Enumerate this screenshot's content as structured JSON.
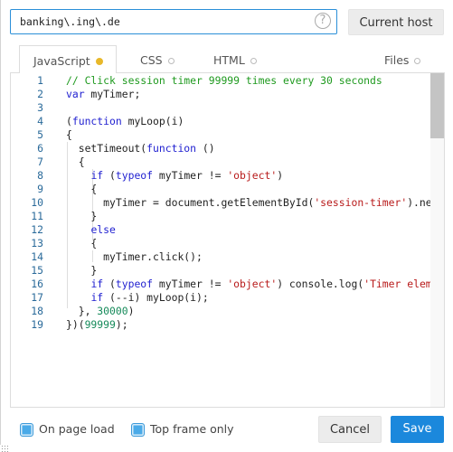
{
  "host": {
    "value": "banking\\.ing\\.de",
    "help_icon": "question-circle-icon",
    "current_host_label": "Current host"
  },
  "tabs": [
    {
      "label": "JavaScript",
      "active": true,
      "status": "modified",
      "dot_color": "#e8b82a"
    },
    {
      "label": "CSS",
      "active": false,
      "status": "empty"
    },
    {
      "label": "HTML",
      "active": false,
      "status": "empty"
    },
    {
      "label": "Files",
      "active": false,
      "status": "empty"
    }
  ],
  "editor": {
    "line_numbers": [
      "1",
      "2",
      "3",
      "4",
      "5",
      "6",
      "7",
      "8",
      "9",
      "10",
      "11",
      "12",
      "13",
      "14",
      "15",
      "16",
      "17",
      "18",
      "19"
    ],
    "lines": [
      [
        [
          "comment",
          "// Click session timer 99999 times every 30 seconds"
        ]
      ],
      [
        [
          "keyword",
          "var"
        ],
        [
          "plain",
          " myTimer;"
        ]
      ],
      [],
      [
        [
          "plain",
          "("
        ],
        [
          "keyword",
          "function"
        ],
        [
          "plain",
          " myLoop(i)"
        ]
      ],
      [
        [
          "plain",
          "{"
        ]
      ],
      [
        [
          "plain",
          "  setTimeout("
        ],
        [
          "keyword",
          "function"
        ],
        [
          "plain",
          " ()"
        ]
      ],
      [
        [
          "plain",
          "  {"
        ]
      ],
      [
        [
          "plain",
          "    "
        ],
        [
          "keyword",
          "if"
        ],
        [
          "plain",
          " ("
        ],
        [
          "keyword",
          "typeof"
        ],
        [
          "plain",
          " myTimer != "
        ],
        [
          "string",
          "'object'"
        ],
        [
          "plain",
          ")"
        ]
      ],
      [
        [
          "plain",
          "    {"
        ]
      ],
      [
        [
          "plain",
          "      myTimer = document.getElementById("
        ],
        [
          "string",
          "'session-timer'"
        ],
        [
          "plain",
          ").nex"
        ]
      ],
      [
        [
          "plain",
          "    }"
        ]
      ],
      [
        [
          "plain",
          "    "
        ],
        [
          "keyword",
          "else"
        ]
      ],
      [
        [
          "plain",
          "    {"
        ]
      ],
      [
        [
          "plain",
          "      myTimer.click();"
        ]
      ],
      [
        [
          "plain",
          "    }"
        ]
      ],
      [
        [
          "plain",
          "    "
        ],
        [
          "keyword",
          "if"
        ],
        [
          "plain",
          " ("
        ],
        [
          "keyword",
          "typeof"
        ],
        [
          "plain",
          " myTimer != "
        ],
        [
          "string",
          "'object'"
        ],
        [
          "plain",
          ") console.log("
        ],
        [
          "string",
          "'Timer eleme"
        ]
      ],
      [
        [
          "plain",
          "    "
        ],
        [
          "keyword",
          "if"
        ],
        [
          "plain",
          " (--i) myLoop(i);"
        ]
      ],
      [
        [
          "plain",
          "  }, "
        ],
        [
          "number",
          "30000"
        ],
        [
          "plain",
          ")"
        ]
      ],
      [
        [
          "plain",
          "})("
        ],
        [
          "number",
          "99999"
        ],
        [
          "plain",
          ");"
        ]
      ]
    ]
  },
  "options": {
    "on_page_load": {
      "label": "On page load",
      "checked": true
    },
    "top_frame_only": {
      "label": "Top frame only",
      "checked": true
    }
  },
  "actions": {
    "cancel_label": "Cancel",
    "save_label": "Save",
    "save_color": "#1b88dc"
  }
}
